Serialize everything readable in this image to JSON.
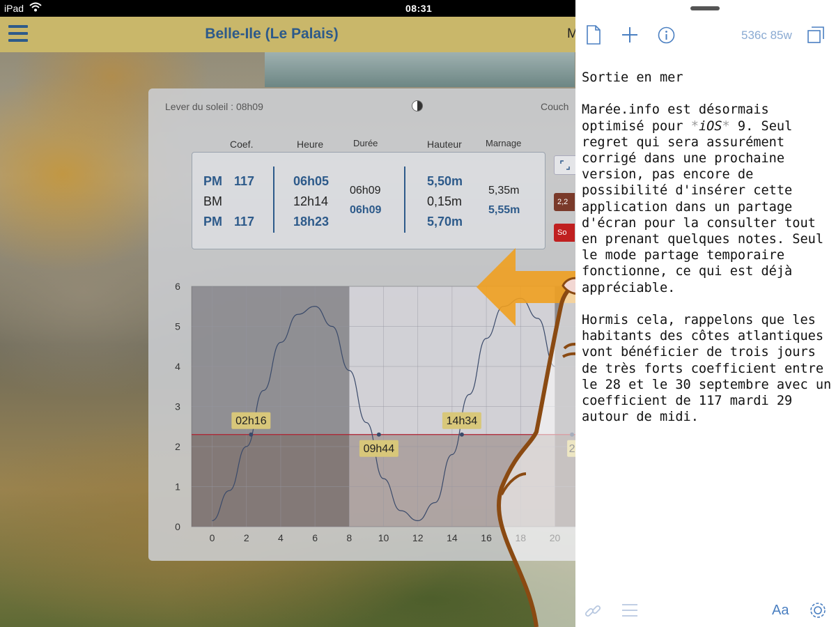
{
  "status_bar": {
    "carrier": "iPad",
    "time": "08:31"
  },
  "nav": {
    "title": "Belle-Ile (Le Palais)",
    "right_label": "M"
  },
  "panel": {
    "sunrise": "Lever du soleil : 08h09",
    "sunset": "Couch",
    "headers": {
      "coef": "Coef.",
      "heure": "Heure",
      "duree": "Durée",
      "hauteur": "Hauteur",
      "marnage": "Marnage"
    },
    "rows": [
      {
        "type": "PM",
        "coef": "117",
        "heure": "06h05",
        "hauteur": "5,50m"
      },
      {
        "type": "BM",
        "coef": "",
        "heure": "12h14",
        "hauteur": "0,15m"
      },
      {
        "type": "PM",
        "coef": "117",
        "heure": "18h23",
        "hauteur": "5,70m"
      }
    ],
    "durations": [
      "06h09",
      "06h09"
    ],
    "marnages": [
      "5,35m",
      "5,55m"
    ],
    "side_buttons": [
      "2,2",
      "So"
    ]
  },
  "chart_data": {
    "type": "line",
    "title": "",
    "xlabel": "",
    "ylabel": "",
    "x_ticks": [
      0,
      2,
      4,
      6,
      8,
      10,
      12,
      14,
      16,
      18,
      20
    ],
    "y_ticks": [
      0,
      1,
      2,
      3,
      4,
      5,
      6
    ],
    "xlim": [
      -1.2,
      21.2
    ],
    "ylim": [
      0,
      6
    ],
    "series": [
      {
        "x": [
          0,
          1,
          2,
          3,
          4,
          5,
          6,
          7,
          8,
          9,
          10,
          11,
          12,
          13,
          14,
          15,
          16,
          17,
          18,
          19,
          20
        ],
        "y": [
          0.15,
          0.9,
          2.0,
          3.4,
          4.6,
          5.3,
          5.5,
          5.0,
          3.9,
          2.6,
          1.2,
          0.4,
          0.15,
          0.6,
          1.8,
          3.3,
          4.7,
          5.5,
          5.7,
          5.2,
          4.0
        ]
      }
    ],
    "threshold": 2.3,
    "night_shading": [
      [
        -1.2,
        8
      ],
      [
        20,
        21.2
      ]
    ],
    "annotations": [
      {
        "label": "02h16",
        "x": 2.27,
        "y": 2.3,
        "position": "above"
      },
      {
        "label": "09h44",
        "x": 9.73,
        "y": 2.3,
        "position": "below"
      },
      {
        "label": "14h34",
        "x": 14.57,
        "y": 2.3,
        "position": "above"
      },
      {
        "label": "2",
        "x": 21.0,
        "y": 2.3,
        "position": "below"
      }
    ],
    "grid": true
  },
  "editor": {
    "word_count": "536c 85w",
    "title": "Sortie en mer",
    "para1_before": "Marée.info est désormais optimisé pour ",
    "para1_mark1": "*",
    "para1_italic": "iOS",
    "para1_mark2": "*",
    "para1_after": " 9. Seul regret qui sera assurément corrigé dans une prochaine version, pas encore de possibilité d'insérer cette application dans un partage d'écran pour la consulter tout en prenant quelques notes. Seul le mode partage temporaire fonctionne, ce qui est déjà appréciable.",
    "para2": "Hormis cela, rappelons que les habitants des côtes atlantiques vont bénéficier de trois jours de très forts coefficient entre le 28 et le 30 septembre avec un coefficient de 117 mardi 29 autour de midi.",
    "font_button": "Aa"
  },
  "colors": {
    "accent": "#2d5a8a",
    "nav_bg": "#c9b76a",
    "editor_icon": "#4a7fc1",
    "arrow": "#f0a020",
    "finger_outline": "#8a4a12"
  }
}
